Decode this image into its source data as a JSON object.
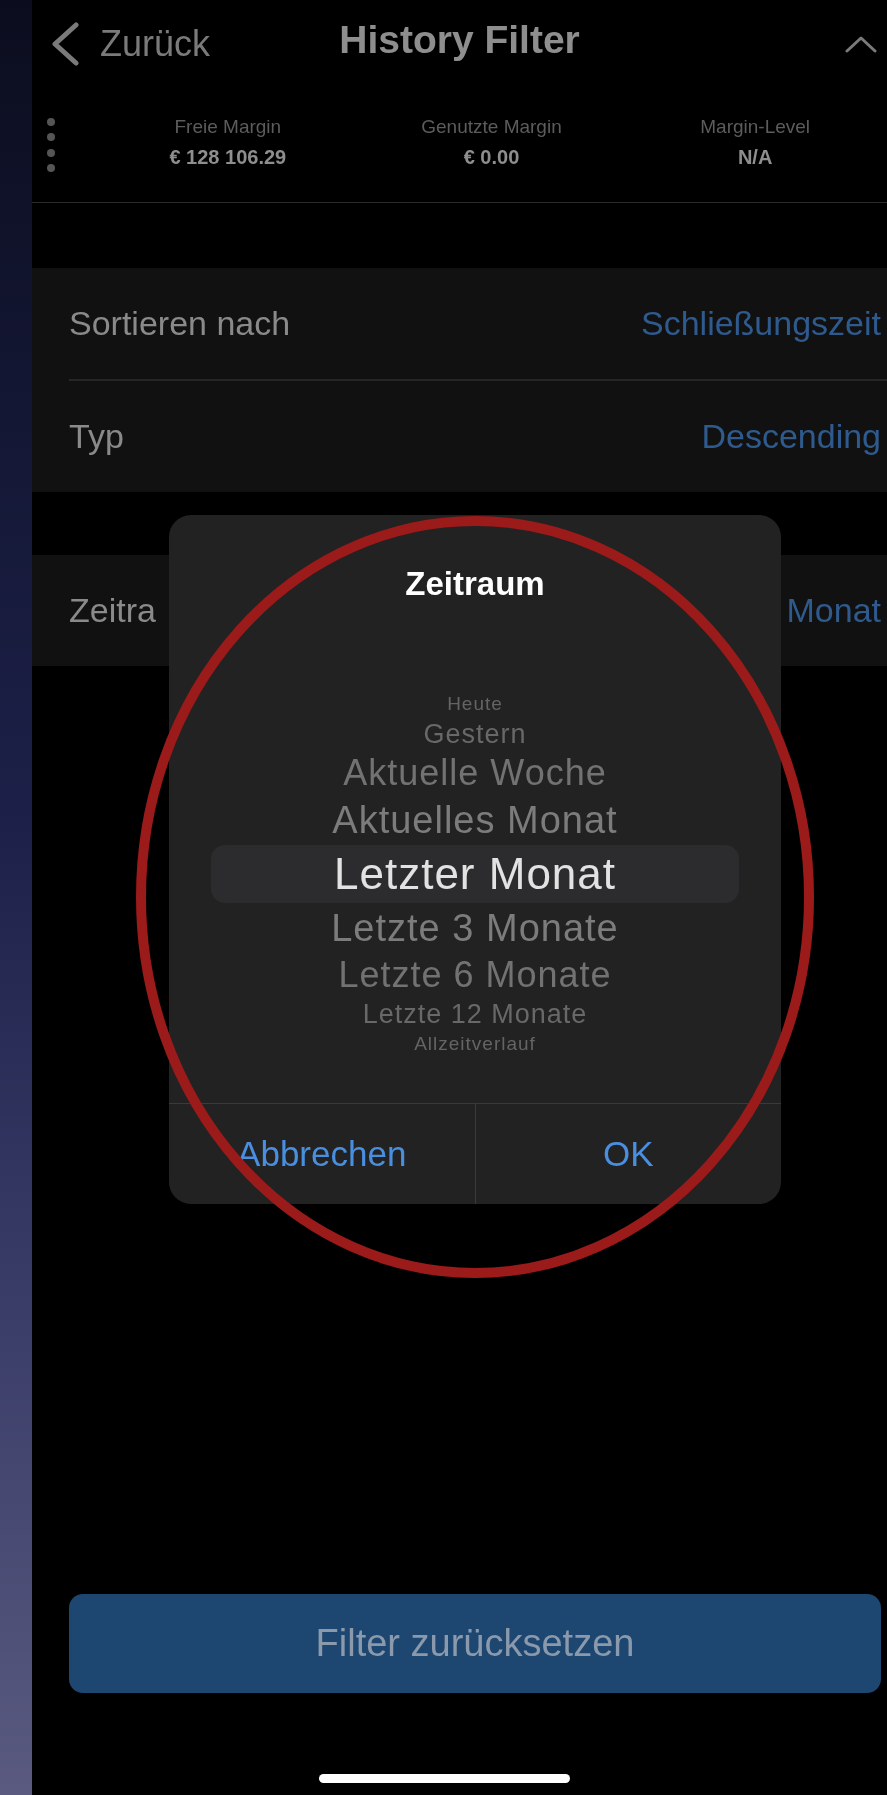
{
  "header": {
    "back": "Zurück",
    "title": "History Filter"
  },
  "margin": [
    {
      "label": "Freie Margin",
      "value": "€ 128 106.29"
    },
    {
      "label": "Genutzte Margin",
      "value": "€ 0.00"
    },
    {
      "label": "Margin-Level",
      "value": "N/A"
    }
  ],
  "sections": [
    {
      "rows": [
        {
          "label": "Sortieren nach",
          "value": "Schließungszeit"
        },
        {
          "label": "Typ",
          "value": "Descending"
        }
      ]
    },
    {
      "rows": [
        {
          "label": "Zeitra",
          "value": "Monat"
        }
      ]
    }
  ],
  "dialog": {
    "title": "Zeitraum",
    "options": [
      {
        "label": "Heute",
        "selected": false
      },
      {
        "label": "Gestern",
        "selected": false
      },
      {
        "label": "Aktuelle Woche",
        "selected": false
      },
      {
        "label": "Aktuelles Monat",
        "selected": false
      },
      {
        "label": "Letzter Monat",
        "selected": true
      },
      {
        "label": "Letzte 3 Monate",
        "selected": false
      },
      {
        "label": "Letzte 6 Monate",
        "selected": false
      },
      {
        "label": "Letzte 12 Monate",
        "selected": false
      },
      {
        "label": "Allzeitverlauf",
        "selected": false
      }
    ],
    "buttons": [
      "Abbrechen",
      "OK"
    ]
  },
  "reset_button": "Filter zurücksetzen"
}
